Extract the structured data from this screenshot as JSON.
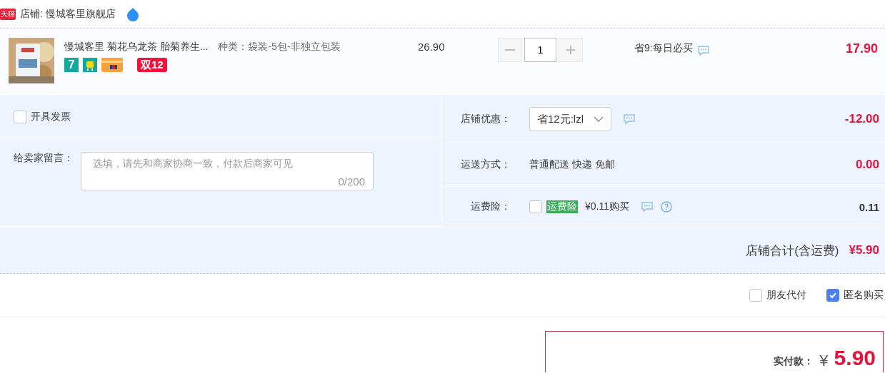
{
  "shop": {
    "badge": "天猫",
    "label": "店铺: 慢城客里旗舰店"
  },
  "item": {
    "title": "慢城客里 菊花乌龙茶 胎菊养生...",
    "spec": "种类：袋装-5包-非独立包装",
    "tag_number": "7",
    "promo_tag": "双12",
    "price": "26.90",
    "quantity": "1",
    "discount": "省9:每日必买",
    "total": "17.90"
  },
  "invoice": {
    "label": "开具发票",
    "checked": false
  },
  "message": {
    "label": "给卖家留言：",
    "placeholder": "选填，请先和商家协商一致，付款后商家可见",
    "counter": "0/200"
  },
  "coupon": {
    "label": "店铺优惠：",
    "value": "省12元:lzl",
    "amount": "-12.00"
  },
  "shipping": {
    "label": "运送方式：",
    "value": "普通配送 快递 免邮",
    "amount": "0.00"
  },
  "insurance": {
    "label": "运费险：",
    "checked": false,
    "tag": "运费险",
    "text": "¥0.11购买",
    "amount": "0.11"
  },
  "subtotal": {
    "label": "店铺合计(含运费)",
    "amount": "¥5.90"
  },
  "options": [
    {
      "label": "朋友代付",
      "checked": false
    },
    {
      "label": "匿名购买",
      "checked": true
    }
  ],
  "payment": {
    "label": "实付款：",
    "currency": "¥",
    "amount": "5.90"
  }
}
